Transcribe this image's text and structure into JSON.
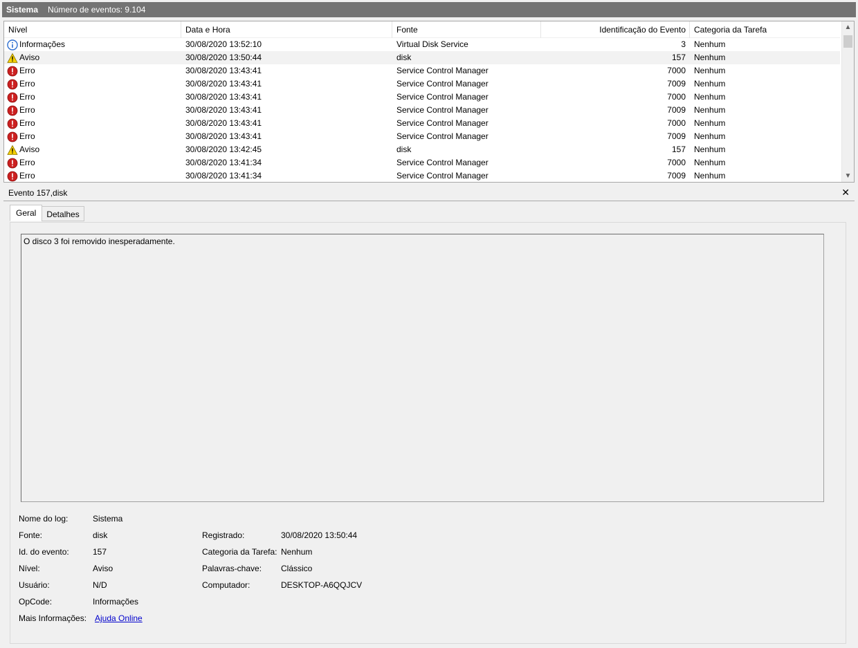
{
  "titlebar": {
    "log_name": "Sistema",
    "event_count": "Número de eventos: 9.104"
  },
  "list": {
    "columns": [
      "Nível",
      "Data e Hora",
      "Fonte",
      "Identificação do Evento",
      "Categoria da Tarefa"
    ],
    "rows": [
      {
        "level": "Informações",
        "icon": "info-icon",
        "datetime": "30/08/2020 13:52:10",
        "source": "Virtual Disk Service",
        "id": "3",
        "category": "Nenhum"
      },
      {
        "level": "Aviso",
        "icon": "warning-icon",
        "datetime": "30/08/2020 13:50:44",
        "source": "disk",
        "id": "157",
        "category": "Nenhum"
      },
      {
        "level": "Erro",
        "icon": "error-icon",
        "datetime": "30/08/2020 13:43:41",
        "source": "Service Control Manager",
        "id": "7000",
        "category": "Nenhum"
      },
      {
        "level": "Erro",
        "icon": "error-icon",
        "datetime": "30/08/2020 13:43:41",
        "source": "Service Control Manager",
        "id": "7009",
        "category": "Nenhum"
      },
      {
        "level": "Erro",
        "icon": "error-icon",
        "datetime": "30/08/2020 13:43:41",
        "source": "Service Control Manager",
        "id": "7000",
        "category": "Nenhum"
      },
      {
        "level": "Erro",
        "icon": "error-icon",
        "datetime": "30/08/2020 13:43:41",
        "source": "Service Control Manager",
        "id": "7009",
        "category": "Nenhum"
      },
      {
        "level": "Erro",
        "icon": "error-icon",
        "datetime": "30/08/2020 13:43:41",
        "source": "Service Control Manager",
        "id": "7000",
        "category": "Nenhum"
      },
      {
        "level": "Erro",
        "icon": "error-icon",
        "datetime": "30/08/2020 13:43:41",
        "source": "Service Control Manager",
        "id": "7009",
        "category": "Nenhum"
      },
      {
        "level": "Aviso",
        "icon": "warning-icon",
        "datetime": "30/08/2020 13:42:45",
        "source": "disk",
        "id": "157",
        "category": "Nenhum"
      },
      {
        "level": "Erro",
        "icon": "error-icon",
        "datetime": "30/08/2020 13:41:34",
        "source": "Service Control Manager",
        "id": "7000",
        "category": "Nenhum"
      },
      {
        "level": "Erro",
        "icon": "error-icon",
        "datetime": "30/08/2020 13:41:34",
        "source": "Service Control Manager",
        "id": "7009",
        "category": "Nenhum"
      }
    ]
  },
  "detail": {
    "title": "Evento 157,disk",
    "close_icon": "close-icon",
    "tabs": [
      "Geral",
      "Detalhes"
    ],
    "message": "O disco 3 foi removido inesperadamente.",
    "props": {
      "log_label": "Nome do log:",
      "log_value": "Sistema",
      "source_label": "Fonte:",
      "source_value": "disk",
      "registered_label": "Registrado:",
      "registered_value": "30/08/2020 13:50:44",
      "id_label": "Id. do evento:",
      "id_value": "157",
      "category_label": "Categoria da Tarefa:",
      "category_value": "Nenhum",
      "level_label": "Nível:",
      "level_value": "Aviso",
      "keywords_label": "Palavras-chave:",
      "keywords_value": "Clássico",
      "user_label": "Usuário:",
      "user_value": "N/D",
      "computer_label": "Computador:",
      "computer_value": "DESKTOP-A6QQJCV",
      "opcode_label": "OpCode:",
      "opcode_value": "Informações",
      "more_label": "Mais Informações:",
      "more_link": "Ajuda Online"
    }
  },
  "colors": {
    "title_bg": "#737373",
    "selected_row": "#e5f0fb",
    "error": "#cc2020",
    "warning": "#f5d000",
    "info": "#2f6fd0",
    "link": "#0000cc"
  }
}
